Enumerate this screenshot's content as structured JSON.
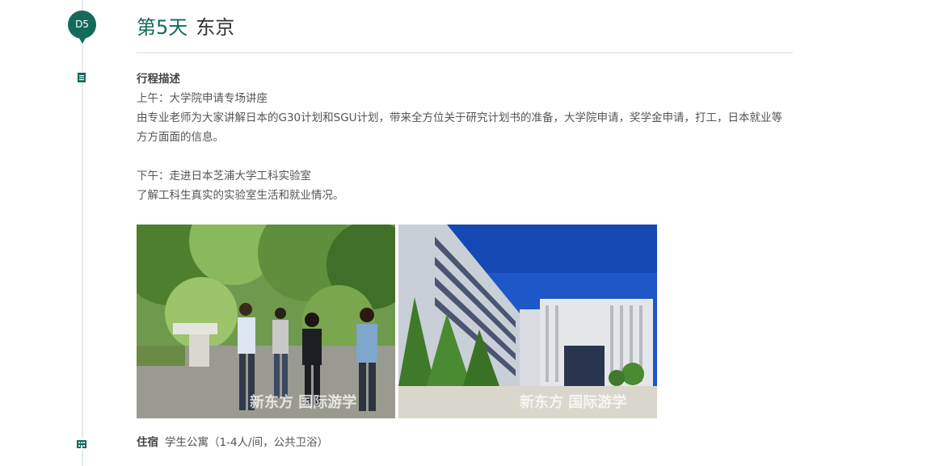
{
  "day": {
    "badge": "D5",
    "title": "第5天",
    "city": "东京"
  },
  "itinerary": {
    "heading": "行程描述",
    "morning_title": "上午：大学院申请专场讲座",
    "morning_text": "由专业老师为大家讲解日本的G30计划和SGU计划，带来全方位关于研究计划书的准备，大学院申请，奖学金申请，打工，日本就业等方方面面的信息。",
    "afternoon_title": "下午：走进日本芝浦大学工科实验室",
    "afternoon_text": "了解工科生真实的实验室生活和就业情况。"
  },
  "photos": {
    "photo1_watermark": "新东方 国际游学",
    "photo2_watermark": "新东方 国际游学"
  },
  "lodging": {
    "label": "住宿",
    "value": "学生公寓（1-4人/间，公共卫浴）"
  },
  "colors": {
    "accent": "#146a5a",
    "text": "#555555"
  },
  "icons": {
    "description": "document-icon",
    "lodging": "building-icon"
  }
}
